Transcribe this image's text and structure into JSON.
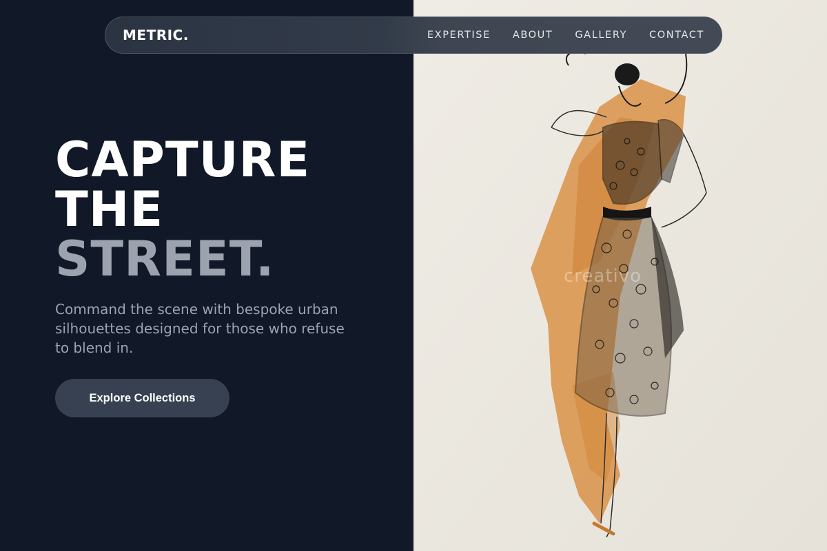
{
  "nav": {
    "logo": "METRIC.",
    "links": [
      "EXPERTISE",
      "ABOUT",
      "GALLERY",
      "CONTACT"
    ]
  },
  "hero": {
    "headline_lines": [
      "CAPTURE",
      "THE",
      "STREET."
    ],
    "subtext": "Command the scene with bespoke urban silhouettes designed for those who refuse to blend in.",
    "cta_label": "Explore Collections"
  },
  "image": {
    "description_icon": "fashion-sketch-illustration",
    "watermark": "creativo"
  },
  "colors": {
    "dark_bg": "#111827",
    "nav_bg": "#374151",
    "muted_text": "#9ca3af",
    "paper": "#ece9e2",
    "wash": "#d98a3a"
  }
}
